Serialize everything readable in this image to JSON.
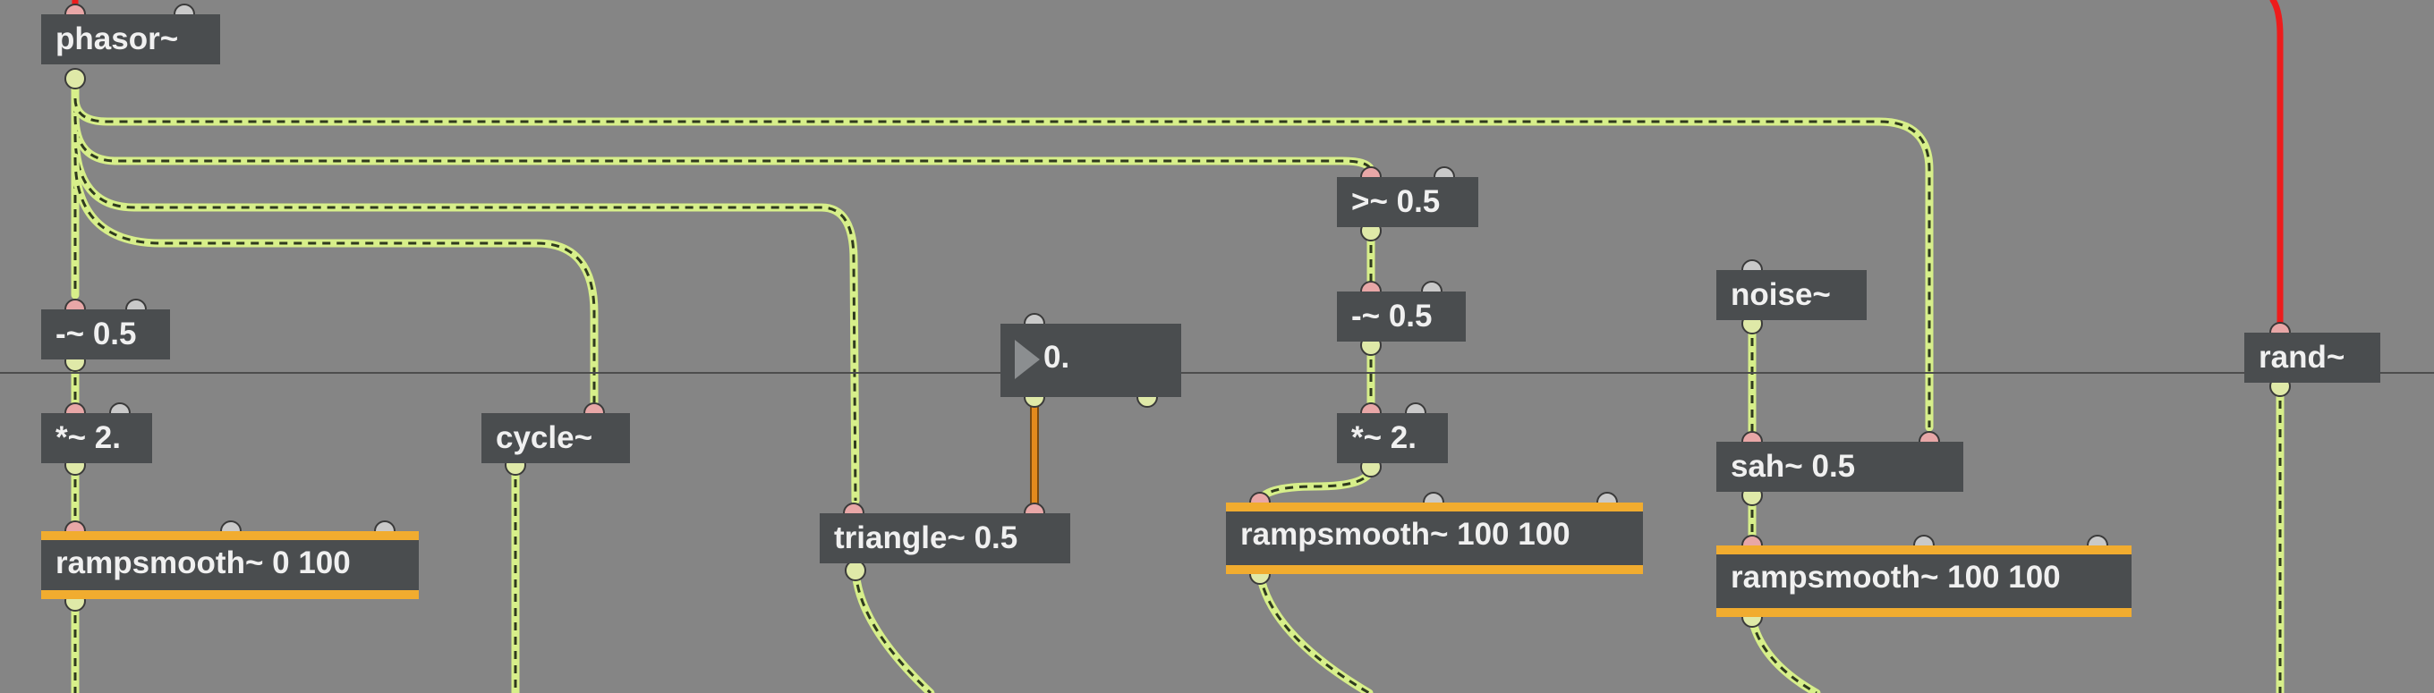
{
  "patcher": {
    "objects": [
      {
        "id": "phasor",
        "text": "phasor~"
      },
      {
        "id": "sub1",
        "text": "-~ 0.5"
      },
      {
        "id": "mul1",
        "text": "*~ 2."
      },
      {
        "id": "rs1",
        "text": "rampsmooth~ 0 100"
      },
      {
        "id": "cycle",
        "text": "cycle~"
      },
      {
        "id": "number",
        "text": "0."
      },
      {
        "id": "triangle",
        "text": "triangle~ 0.5"
      },
      {
        "id": "gte",
        "text": ">~ 0.5"
      },
      {
        "id": "sub2",
        "text": "-~ 0.5"
      },
      {
        "id": "mul2",
        "text": "*~ 2."
      },
      {
        "id": "rs2",
        "text": "rampsmooth~ 100 100"
      },
      {
        "id": "noise",
        "text": "noise~"
      },
      {
        "id": "sah",
        "text": "sah~ 0.5"
      },
      {
        "id": "rs3",
        "text": "rampsmooth~ 100 100"
      },
      {
        "id": "rand",
        "text": "rand~"
      }
    ]
  },
  "colors": {
    "canvas": "#858585",
    "object": "#4a4d4f",
    "signal_cord": "#d7ef8a",
    "float_cord": "#e38a1d",
    "control_cord": "#ee1c1c",
    "rampsmooth_accent": "#f1ac2f"
  }
}
